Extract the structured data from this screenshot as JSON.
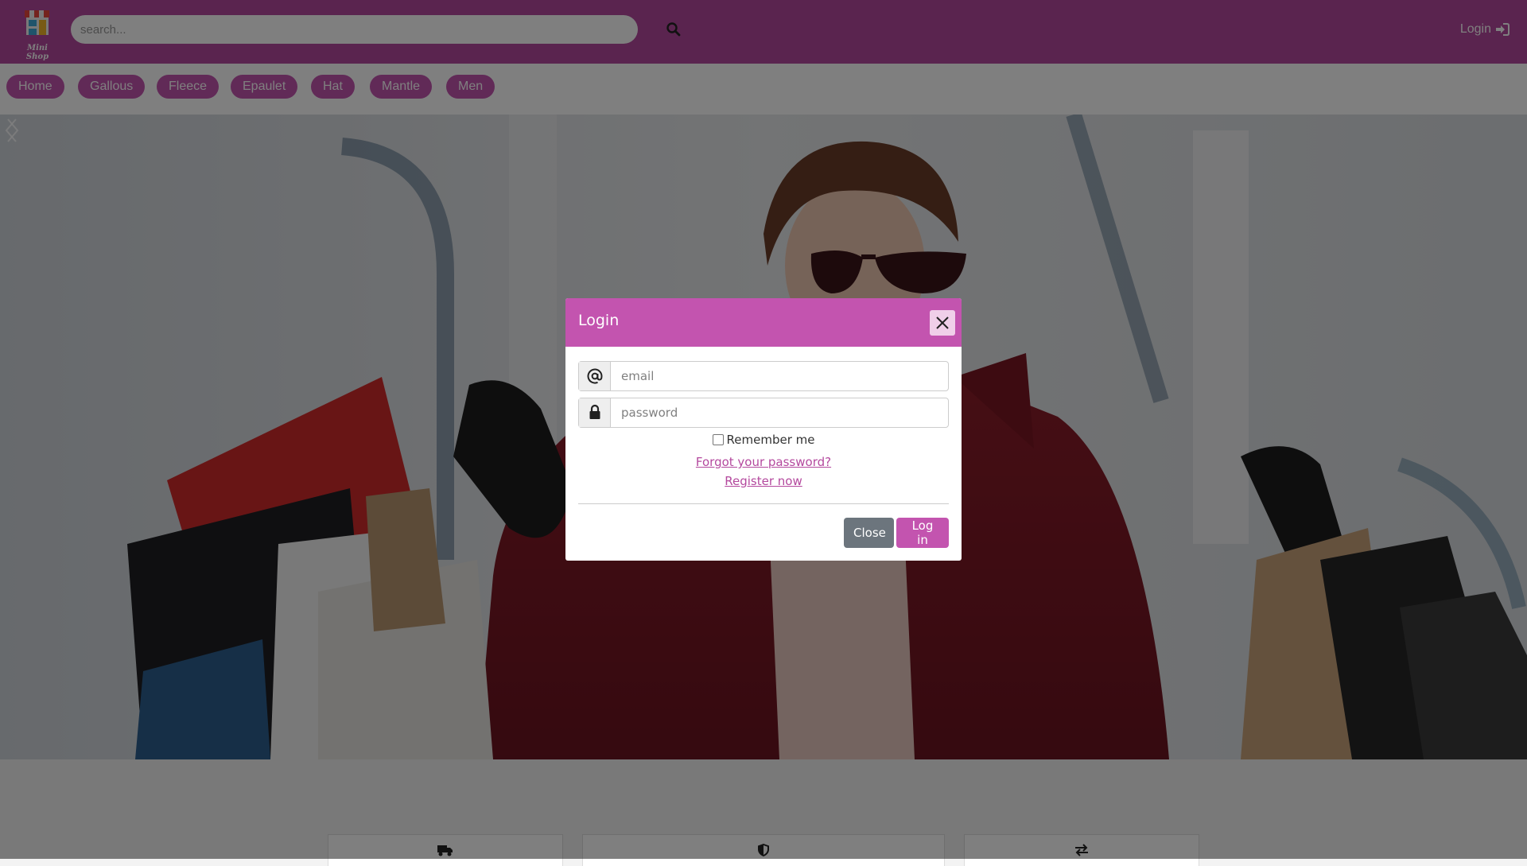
{
  "header": {
    "logo_text": "Mini Shop",
    "search_placeholder": "search...",
    "login_label": "Login",
    "brand_color": "#b4499e",
    "icons": [
      "store-logo-icon",
      "search-icon",
      "sign-in-icon"
    ]
  },
  "categories": [
    {
      "label": "Home"
    },
    {
      "label": "Gallous"
    },
    {
      "label": "Fleece"
    },
    {
      "label": "Epaulet"
    },
    {
      "label": "Hat"
    },
    {
      "label": "Mantle"
    },
    {
      "label": "Men"
    }
  ],
  "hero": {
    "controls": [
      "chevron-left-icon",
      "chevron-right-icon"
    ]
  },
  "features": [
    {
      "icon": "truck-icon"
    },
    {
      "icon": "shield-icon"
    },
    {
      "icon": "exchange-icon"
    }
  ],
  "modal": {
    "title": "Login",
    "email_placeholder": "email",
    "password_placeholder": "password",
    "email_icon": "at-icon",
    "password_icon": "lock-icon",
    "remember_label": "Remember me",
    "forgot_link": "Forgot your password?",
    "register_link": "Register now",
    "close_label": "Close",
    "login_label": "Log in",
    "accent_color": "#c354af"
  }
}
